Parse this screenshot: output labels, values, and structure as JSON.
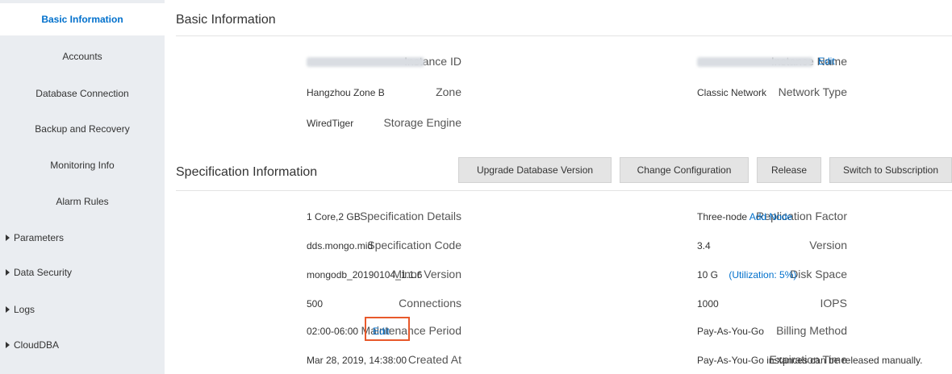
{
  "sidebar": {
    "items": [
      {
        "label": "Basic Information",
        "expandable": false,
        "active": true
      },
      {
        "label": "Accounts",
        "expandable": false,
        "active": false
      },
      {
        "label": "Database Connection",
        "expandable": false,
        "active": false
      },
      {
        "label": "Backup and Recovery",
        "expandable": false,
        "active": false
      },
      {
        "label": "Monitoring Info",
        "expandable": false,
        "active": false
      },
      {
        "label": "Alarm Rules",
        "expandable": false,
        "active": false
      },
      {
        "label": "Parameters",
        "expandable": true,
        "active": false
      },
      {
        "label": "Data Security",
        "expandable": true,
        "active": false
      },
      {
        "label": "Logs",
        "expandable": true,
        "active": false
      },
      {
        "label": "CloudDBA",
        "expandable": true,
        "active": false
      }
    ]
  },
  "basic": {
    "title": "Basic Information",
    "instance_id_label": "Instance ID",
    "instance_name_label": "Instance Name",
    "edit_link": "Edit",
    "zone_label": "Zone",
    "zone_value": "Hangzhou Zone B",
    "network_type_label": "Network Type",
    "network_type_value": "Classic Network",
    "storage_engine_label": "Storage Engine",
    "storage_engine_value": "WiredTiger"
  },
  "spec": {
    "title": "Specification Information",
    "buttons": {
      "upgrade": "Upgrade Database Version",
      "change_config": "Change Configuration",
      "release": "Release",
      "switch_subscription": "Switch to Subscription"
    },
    "details_label": "Specification Details",
    "details_value": "1 Core,2 GB",
    "replication_label": "Replication Factor",
    "replication_value": "Three-node",
    "add_node_link": "Add Node",
    "code_label": "Specification Code",
    "code_value": "dds.mongo.mid",
    "version_label": "Version",
    "version_value": "3.4",
    "minor_label": "Minor Version",
    "minor_value": "mongodb_20190104_1.1.6",
    "disk_label": "Disk Space",
    "disk_value": "10 G",
    "disk_util": "(Utilization: 5%)",
    "connections_label": "Connections",
    "connections_value": "500",
    "iops_label": "IOPS",
    "iops_value": "1000",
    "maintenance_label": "Maintenance Period",
    "maintenance_value": "02:00-06:00",
    "maintenance_edit": "Edit",
    "billing_label": "Billing Method",
    "billing_value": "Pay-As-You-Go",
    "created_label": "Created At",
    "created_value": "Mar 28, 2019, 14:38:00",
    "expiration_label": "Expiration Time",
    "expiration_value": "Pay-As-You-Go instances can be released manually."
  },
  "colors": {
    "accent": "#0070cc",
    "sidebar_bg": "#eaedf1",
    "highlight": "#e8592b"
  }
}
